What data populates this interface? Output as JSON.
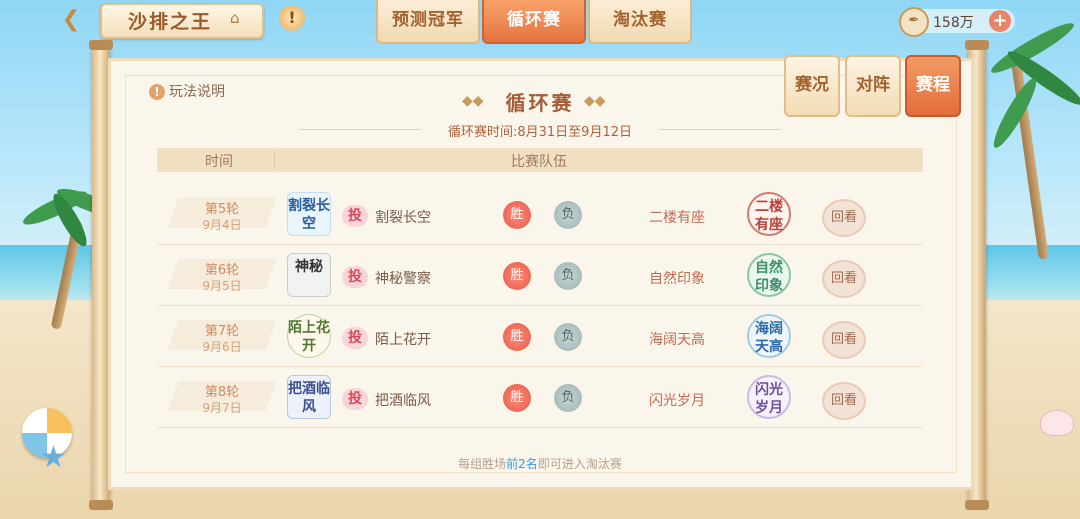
{
  "header": {
    "title": "沙排之王",
    "alert_label": "!",
    "tabs": [
      {
        "label": "预测冠军",
        "active": false
      },
      {
        "label": "循环赛",
        "active": true
      },
      {
        "label": "淘汰赛",
        "active": false
      }
    ],
    "currency": {
      "amount": "158万",
      "add_label": "+"
    }
  },
  "panel": {
    "rules_label": "玩法说明",
    "title": "循环赛",
    "period": "循环赛时间:8月31日至9月12日",
    "side_tabs": [
      {
        "label": "赛况",
        "active": false
      },
      {
        "label": "对阵",
        "active": false
      },
      {
        "label": "赛程",
        "active": true
      }
    ],
    "table": {
      "col_time": "时间",
      "col_teams": "比赛队伍"
    },
    "rows": [
      {
        "round": "第5轮",
        "date": "9月4日",
        "team_left": "割裂长空",
        "logo_left": "割裂长空",
        "vote": "投",
        "win": "胜",
        "lose": "负",
        "team_right": "二楼有座",
        "logo_right": "二楼有座",
        "replay": "回看"
      },
      {
        "round": "第6轮",
        "date": "9月5日",
        "team_left": "神秘警察",
        "logo_left": "神秘",
        "vote": "投",
        "win": "胜",
        "lose": "负",
        "team_right": "自然印象",
        "logo_right": "自然印象",
        "replay": "回看"
      },
      {
        "round": "第7轮",
        "date": "9月6日",
        "team_left": "陌上花开",
        "logo_left": "陌上花开",
        "vote": "投",
        "win": "胜",
        "lose": "负",
        "team_right": "海阔天高",
        "logo_right": "海阔天高",
        "replay": "回看"
      },
      {
        "round": "第8轮",
        "date": "9月7日",
        "team_left": "把酒临风",
        "logo_left": "把酒临风",
        "vote": "投",
        "win": "胜",
        "lose": "负",
        "team_right": "闪光岁月",
        "logo_right": "闪光岁月",
        "replay": "回看"
      }
    ],
    "footer": {
      "prefix": "每组胜场",
      "highlight": "前2名",
      "suffix": "即可进入淘汰赛"
    }
  },
  "colors": {
    "accent": "#e5733f",
    "win": "#e55a48",
    "lose": "#9bb2b2",
    "highlight": "#3d9ad5"
  }
}
